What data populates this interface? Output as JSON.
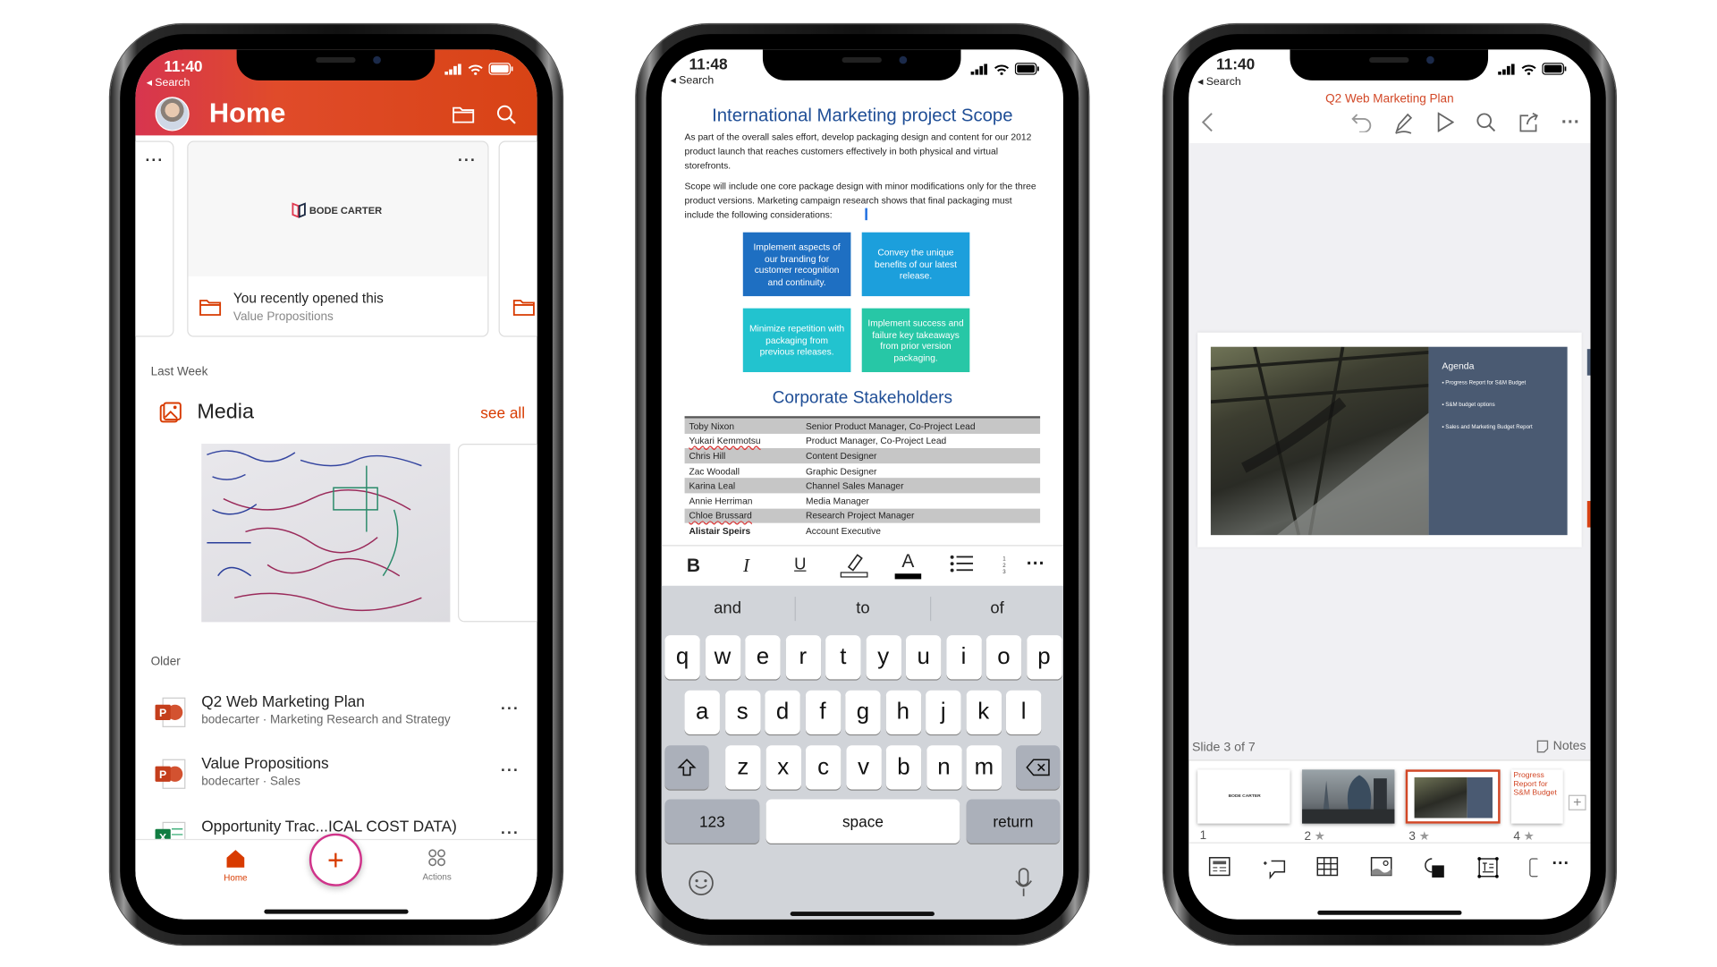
{
  "phone_home": {
    "status": {
      "time": "11:40",
      "back_label": "Search"
    },
    "header": {
      "title": "Home",
      "icons": [
        "folder-icon",
        "search-icon"
      ]
    },
    "recent_card": {
      "logo_text": "BODE CARTER",
      "title": "You recently opened this",
      "subtitle": "Value Propositions"
    },
    "sections": {
      "last_week": "Last Week",
      "older": "Older"
    },
    "media": {
      "title": "Media",
      "see_all": "see all"
    },
    "files": [
      {
        "title": "Q2 Web Marketing Plan",
        "subtitle": "bodecarter · Marketing Research and Strategy",
        "type": "powerpoint"
      },
      {
        "title": "Value Propositions",
        "subtitle": "bodecarter · Sales",
        "type": "powerpoint"
      },
      {
        "title": "Opportunity Trac...ICAL COST DATA)",
        "subtitle": "",
        "type": "excel"
      }
    ],
    "tabbar": {
      "home": "Home",
      "actions": "Actions"
    },
    "accent": "#d83b01"
  },
  "phone_word": {
    "status": {
      "time": "11:48",
      "back_label": "Search"
    },
    "doc": {
      "title": "International Marketing project Scope",
      "para1": "As part of the overall sales effort, develop packaging design and content for our 2012 product launch that reaches customers effectively in both physical and virtual storefronts.",
      "para2": "Scope will include one core package design with minor modifications only for the three product versions.  Marketing campaign research shows that final packaging must include the following considerations:",
      "boxes": [
        {
          "text": "Implement aspects of our branding for customer recognition and continuity.",
          "color": "#1e6fc2"
        },
        {
          "text": "Convey the unique benefits of our latest release.",
          "color": "#1c9fdc"
        },
        {
          "text": "Minimize repetition with packaging from previous releases.",
          "color": "#22c3cf"
        },
        {
          "text": "Implement success and failure key takeaways from prior version packaging.",
          "color": "#27c7a6"
        }
      ],
      "stakeholders_title": "Corporate Stakeholders",
      "stakeholders": [
        [
          "Toby Nixon",
          "Senior Product Manager, Co-Project Lead"
        ],
        [
          "Yukari Kemmotsu",
          "Product Manager, Co-Project Lead"
        ],
        [
          "Chris Hill",
          "Content Designer"
        ],
        [
          "Zac Woodall",
          "Graphic Designer"
        ],
        [
          "Karina Leal",
          "Channel Sales Manager"
        ],
        [
          "Annie Herriman",
          "Media Manager"
        ],
        [
          "Chloe Brussard",
          "Research Project Manager"
        ],
        [
          "Alistair Speirs",
          "Account Executive"
        ]
      ]
    },
    "format_bar": {
      "bold": "B",
      "italic": "I",
      "underline": "U",
      "font_color": "A"
    },
    "keyboard": {
      "suggestions": [
        "and",
        "to",
        "of"
      ],
      "row1": [
        "q",
        "w",
        "e",
        "r",
        "t",
        "y",
        "u",
        "i",
        "o",
        "p"
      ],
      "row2": [
        "a",
        "s",
        "d",
        "f",
        "g",
        "h",
        "j",
        "k",
        "l"
      ],
      "row3": [
        "z",
        "x",
        "c",
        "v",
        "b",
        "n",
        "m"
      ],
      "numbers": "123",
      "space": "space",
      "return": "return"
    }
  },
  "phone_ppt": {
    "status": {
      "time": "11:40",
      "back_label": "Search"
    },
    "title": "Q2 Web Marketing Plan",
    "slide": {
      "heading": "Agenda",
      "bullets": [
        "Progress Report for S&M Budget",
        "S&M budget options",
        "Sales and Marketing Budget Report"
      ]
    },
    "slide_counter": "Slide 3 of 7",
    "notes_label": "Notes",
    "thumbnails": [
      {
        "number": "1",
        "logo_text": "BODE CARTER"
      },
      {
        "number": "2"
      },
      {
        "number": "3",
        "selected": true
      },
      {
        "number": "4",
        "title": "Progress Report for S&M Budget"
      }
    ],
    "accent": "#d24726"
  }
}
